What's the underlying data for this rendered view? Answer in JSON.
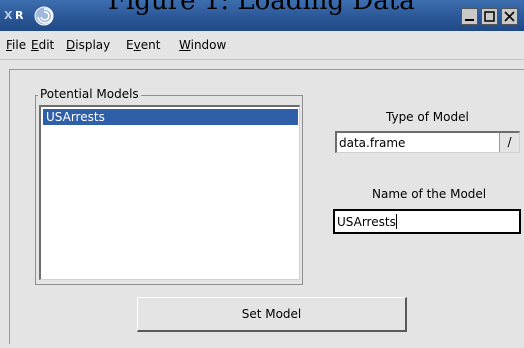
{
  "caption": "Figure 1: Loading Data",
  "window": {
    "app_icon_letter": "R",
    "titlebar_color": "#2b5797",
    "minimize_icon": "minimize-icon",
    "maximize_icon": "maximize-icon",
    "close_icon": "close-icon"
  },
  "menu": {
    "items": [
      {
        "label_ul": "F",
        "label_rest": "ile"
      },
      {
        "label_ul": "E",
        "label_rest": "dit"
      },
      {
        "label_ul": "D",
        "label_rest": "isplay"
      },
      {
        "label_pre": "E",
        "label_ul": "v",
        "label_rest": "ent"
      },
      {
        "label_ul": "W",
        "label_rest": "indow"
      }
    ]
  },
  "models_group": {
    "legend": "Potential Models",
    "items": [
      "USArrests"
    ],
    "selected": "USArrests",
    "selection_color": "#2f5fa8"
  },
  "type_of_model": {
    "label": "Type of Model",
    "value": "data.frame",
    "button_glyph": "/"
  },
  "name_of_model": {
    "label": "Name of the Model",
    "value": "USArrests"
  },
  "set_model_button": {
    "label": "Set Model"
  }
}
